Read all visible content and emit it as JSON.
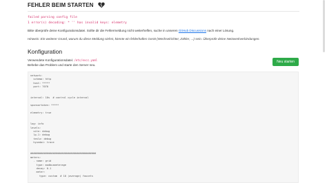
{
  "header": {
    "title": "FEHLER BEIM STARTEN"
  },
  "error": {
    "line1": "failed parsing config file",
    "line2": "1 error(s) decoding: * '' has invalid keys: elemetry"
  },
  "note": {
    "text_before_link": "Bitte überprüfe deine Konfigurationsdatei. Sollte dir die Fehlermeldung nicht weiterhelfen, suche in unseren ",
    "link": "GitHub Discussions",
    "text_after_link": " nach einer Lösung."
  },
  "hint": "Hinweis: Ein weiterer Grund, warum du diese Meldung siehst, könnte ein fehlerhaftes Gerät (Wechselrichter, Zähler, ...) sein. Überprüfe deine Netzwerkverbindungen.",
  "config": {
    "title": "Konfiguration",
    "file_label": "Verwendete Konfigurationsdatei:",
    "file_path": "/etc/evcc.yaml",
    "instruction": "Behebe das Problem und starte den Server neu.",
    "restart_label": "Neu starten"
  },
  "code_lines": [
    "network:",
    "  schema: http",
    "  host: *****",
    "  port: 7070",
    "",
    "",
    "interval: 10s  # control cycle interval",
    "",
    "sponsortoken: *****",
    "",
    "elemetry: true",
    "",
    "",
    "log: info",
    "levels:",
    "  site: debug",
    "  lp-1: debug",
    "  tesla: debug",
    "  hyundai: trace",
    "",
    "",
    "############################################",
    "meters:",
    "  - name: grid",
    "    type: modbusmeterage",
    "    decay: 0.1",
    "    meter:",
    "      type: custom  # 10 (average) faucets"
  ]
}
